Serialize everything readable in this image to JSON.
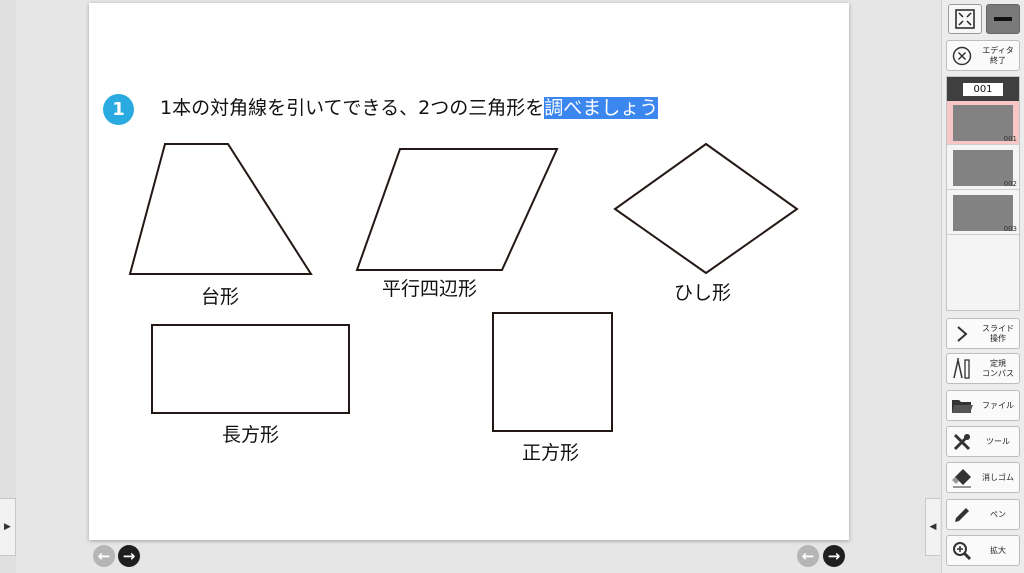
{
  "question": {
    "number": "1",
    "text": "1本の対角線を引いてできる、2つの三角形を",
    "highlight": "調べましょう"
  },
  "shapes": {
    "trapezoid": "台形",
    "parallelogram": "平行四辺形",
    "rhombus": "ひし形",
    "rectangle": "長方形",
    "square": "正方形"
  },
  "sidebar": {
    "exit_label": "エディタ\n終了",
    "current_page": "001",
    "pages": [
      "001",
      "002",
      "003"
    ],
    "tools": [
      {
        "id": "slide",
        "label": "スライド\n操作",
        "icon": "chevron-right-icon"
      },
      {
        "id": "compass",
        "label": "定規\nコンパス",
        "icon": "compass-icon"
      },
      {
        "id": "file",
        "label": "ファイル",
        "icon": "folder-icon"
      },
      {
        "id": "tool",
        "label": "ツール",
        "icon": "wrench-icon"
      },
      {
        "id": "eraser",
        "label": "消しゴム",
        "icon": "eraser-icon"
      },
      {
        "id": "pen",
        "label": "ペン",
        "icon": "pen-icon"
      },
      {
        "id": "zoom",
        "label": "拡大",
        "icon": "zoom-in-icon"
      }
    ]
  },
  "colors": {
    "accent": "#29abe2",
    "highlight": "#3c86f0"
  }
}
